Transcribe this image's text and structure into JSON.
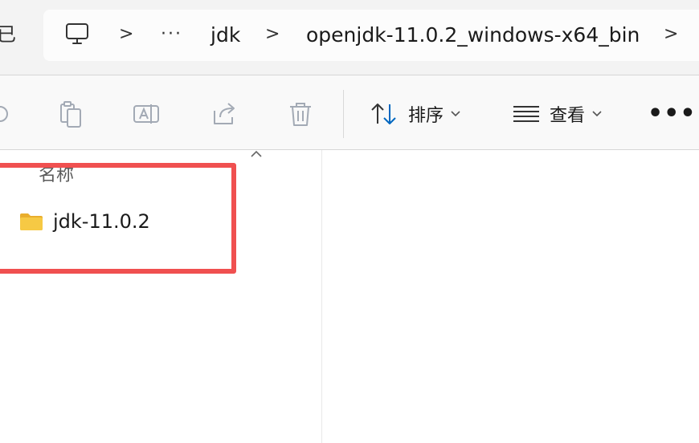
{
  "window": {
    "left_edge_glyph": "已"
  },
  "address_bar": {
    "root_icon": "this-pc-icon",
    "overflow": "···",
    "separator": ">",
    "crumbs": [
      "jdk",
      "openjdk-11.0.2_windows-x64_bin"
    ]
  },
  "command_bar": {
    "icons": [
      "copy-icon",
      "rename-icon",
      "share-icon",
      "delete-icon"
    ],
    "sort": {
      "label": "排序",
      "icon": "sort-arrows-icon"
    },
    "view": {
      "label": "查看",
      "icon": "view-list-icon"
    },
    "more": "•••"
  },
  "file_list": {
    "column_name": "名称",
    "items": [
      {
        "name": "jdk-11.0.2",
        "icon": "folder-icon"
      }
    ]
  },
  "colors": {
    "highlight": "#f05050",
    "folder": "#f6c944",
    "accent": "#0067c0"
  }
}
